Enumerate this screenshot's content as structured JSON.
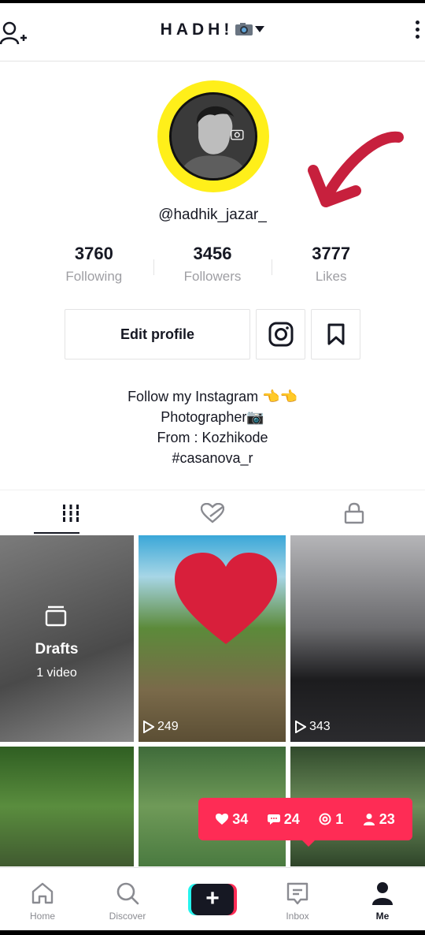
{
  "header": {
    "title": "HADH!",
    "title_emoji_icon": "camera-icon"
  },
  "profile": {
    "handle": "@hadhik_jazar_",
    "stats": [
      {
        "value": "3760",
        "label": "Following"
      },
      {
        "value": "3456",
        "label": "Followers"
      },
      {
        "value": "3777",
        "label": "Likes"
      }
    ],
    "edit_label": "Edit profile",
    "bio": [
      "Follow my Instagram 👈👈",
      "Photographer📷",
      "From : Kozhikode",
      "#casanova_r"
    ]
  },
  "grid": {
    "drafts_title": "Drafts",
    "drafts_count": "1 video",
    "videos": [
      {
        "views": "249"
      },
      {
        "views": "343"
      }
    ]
  },
  "notifications": {
    "likes": "34",
    "comments": "24",
    "mentions": "1",
    "followers": "23"
  },
  "nav": {
    "home": "Home",
    "discover": "Discover",
    "inbox": "Inbox",
    "me": "Me",
    "create": "+"
  },
  "colors": {
    "accent": "#fe2c55",
    "cyan": "#25f4ee",
    "avatar_ring": "#ffef1a"
  }
}
